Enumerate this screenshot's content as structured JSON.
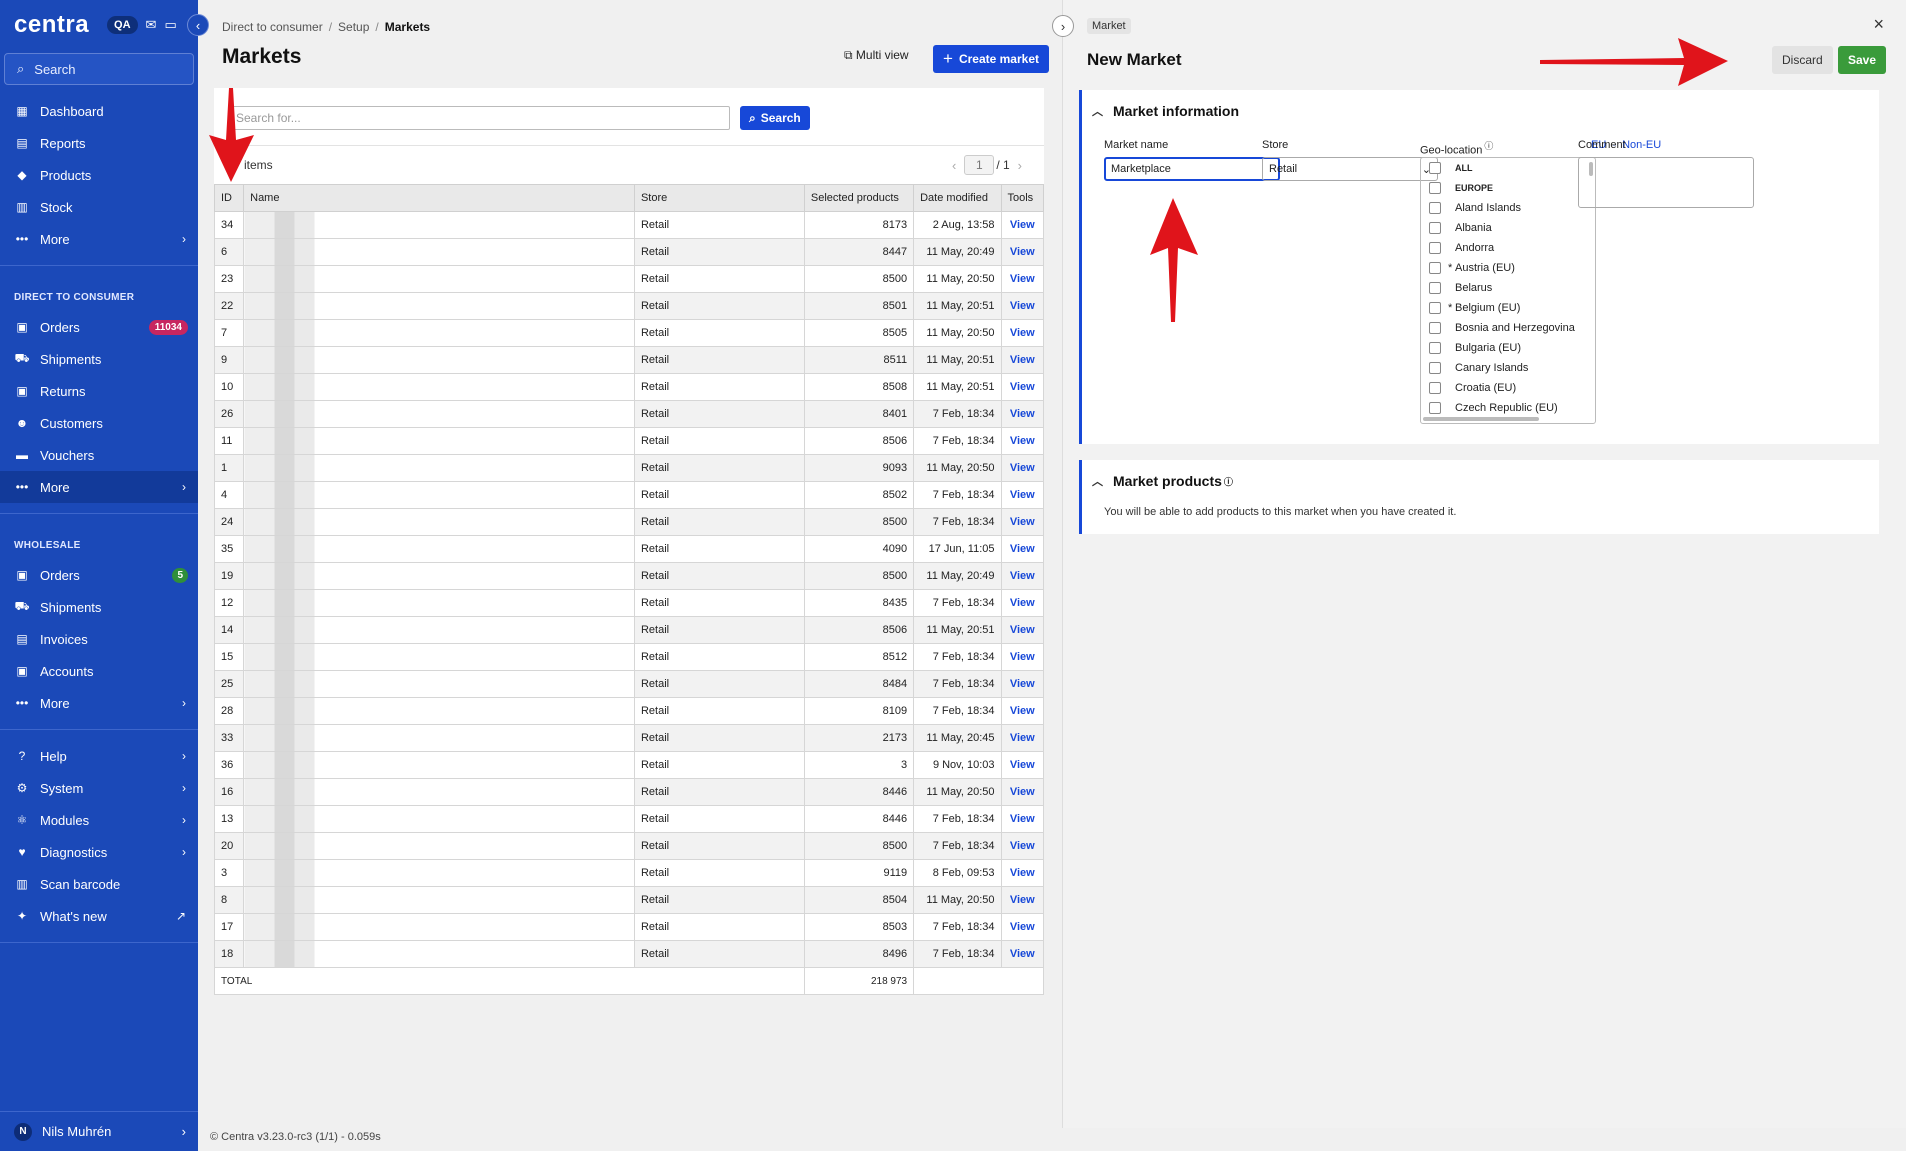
{
  "sidebar": {
    "logo": "centra",
    "env_badge": "QA",
    "search_label": "Search",
    "top_items": [
      {
        "label": "Dashboard",
        "icon": "chart-icon"
      },
      {
        "label": "Reports",
        "icon": "report-icon"
      },
      {
        "label": "Products",
        "icon": "tag-icon"
      },
      {
        "label": "Stock",
        "icon": "stock-icon"
      },
      {
        "label": "More",
        "icon": "dots-icon"
      }
    ],
    "dtc_section": "DIRECT TO CONSUMER",
    "dtc_items": [
      {
        "label": "Orders",
        "badge": "11034"
      },
      {
        "label": "Shipments"
      },
      {
        "label": "Returns"
      },
      {
        "label": "Customers"
      },
      {
        "label": "Vouchers"
      },
      {
        "label": "More"
      }
    ],
    "wholesale_section": "WHOLESALE",
    "wholesale_items": [
      {
        "label": "Orders",
        "badge": "5"
      },
      {
        "label": "Shipments"
      },
      {
        "label": "Invoices"
      },
      {
        "label": "Accounts"
      },
      {
        "label": "More"
      }
    ],
    "bottom_items": [
      {
        "label": "Help"
      },
      {
        "label": "System"
      },
      {
        "label": "Modules"
      },
      {
        "label": "Diagnostics"
      },
      {
        "label": "Scan barcode"
      },
      {
        "label": "What's new"
      }
    ],
    "user": {
      "initial": "N",
      "name": "Nils Muhrén"
    }
  },
  "breadcrumb": [
    "Direct to consumer",
    "Setup",
    "Markets"
  ],
  "page_title": "Markets",
  "multi_view": "Multi view",
  "create_market": "Create market",
  "search": {
    "placeholder": "Search for...",
    "button": "Search"
  },
  "items_label": "items",
  "pager": {
    "current": "1",
    "total": "/ 1"
  },
  "table": {
    "headers": [
      "ID",
      "Name",
      "Store",
      "Selected products",
      "Date modified",
      "Tools"
    ],
    "rows": [
      {
        "id": "34",
        "store": "Retail",
        "selected": "8173",
        "date": "2 Aug, 13:58",
        "tool": "View"
      },
      {
        "id": "6",
        "store": "Retail",
        "selected": "8447",
        "date": "11 May, 20:49",
        "tool": "View"
      },
      {
        "id": "23",
        "store": "Retail",
        "selected": "8500",
        "date": "11 May, 20:50",
        "tool": "View"
      },
      {
        "id": "22",
        "store": "Retail",
        "selected": "8501",
        "date": "11 May, 20:51",
        "tool": "View"
      },
      {
        "id": "7",
        "store": "Retail",
        "selected": "8505",
        "date": "11 May, 20:50",
        "tool": "View"
      },
      {
        "id": "9",
        "store": "Retail",
        "selected": "8511",
        "date": "11 May, 20:51",
        "tool": "View"
      },
      {
        "id": "10",
        "store": "Retail",
        "selected": "8508",
        "date": "11 May, 20:51",
        "tool": "View"
      },
      {
        "id": "26",
        "store": "Retail",
        "selected": "8401",
        "date": "7 Feb, 18:34",
        "tool": "View"
      },
      {
        "id": "11",
        "store": "Retail",
        "selected": "8506",
        "date": "7 Feb, 18:34",
        "tool": "View"
      },
      {
        "id": "1",
        "store": "Retail",
        "selected": "9093",
        "date": "11 May, 20:50",
        "tool": "View"
      },
      {
        "id": "4",
        "store": "Retail",
        "selected": "8502",
        "date": "7 Feb, 18:34",
        "tool": "View"
      },
      {
        "id": "24",
        "store": "Retail",
        "selected": "8500",
        "date": "7 Feb, 18:34",
        "tool": "View"
      },
      {
        "id": "35",
        "store": "Retail",
        "selected": "4090",
        "date": "17 Jun, 11:05",
        "tool": "View"
      },
      {
        "id": "19",
        "store": "Retail",
        "selected": "8500",
        "date": "11 May, 20:49",
        "tool": "View"
      },
      {
        "id": "12",
        "store": "Retail",
        "selected": "8435",
        "date": "7 Feb, 18:34",
        "tool": "View"
      },
      {
        "id": "14",
        "store": "Retail",
        "selected": "8506",
        "date": "11 May, 20:51",
        "tool": "View"
      },
      {
        "id": "15",
        "store": "Retail",
        "selected": "8512",
        "date": "7 Feb, 18:34",
        "tool": "View"
      },
      {
        "id": "25",
        "store": "Retail",
        "selected": "8484",
        "date": "7 Feb, 18:34",
        "tool": "View"
      },
      {
        "id": "28",
        "store": "Retail",
        "selected": "8109",
        "date": "7 Feb, 18:34",
        "tool": "View"
      },
      {
        "id": "33",
        "store": "Retail",
        "selected": "2173",
        "date": "11 May, 20:45",
        "tool": "View"
      },
      {
        "id": "36",
        "store": "Retail",
        "selected": "3",
        "date": "9 Nov, 10:03",
        "tool": "View"
      },
      {
        "id": "16",
        "store": "Retail",
        "selected": "8446",
        "date": "11 May, 20:50",
        "tool": "View"
      },
      {
        "id": "13",
        "store": "Retail",
        "selected": "8446",
        "date": "7 Feb, 18:34",
        "tool": "View"
      },
      {
        "id": "20",
        "store": "Retail",
        "selected": "8500",
        "date": "7 Feb, 18:34",
        "tool": "View"
      },
      {
        "id": "3",
        "store": "Retail",
        "selected": "9119",
        "date": "8 Feb, 09:53",
        "tool": "View"
      },
      {
        "id": "8",
        "store": "Retail",
        "selected": "8504",
        "date": "11 May, 20:50",
        "tool": "View"
      },
      {
        "id": "17",
        "store": "Retail",
        "selected": "8503",
        "date": "7 Feb, 18:34",
        "tool": "View"
      },
      {
        "id": "18",
        "store": "Retail",
        "selected": "8496",
        "date": "7 Feb, 18:34",
        "tool": "View"
      }
    ],
    "total_label": "TOTAL",
    "total_value": "218 973"
  },
  "footer": "© Centra v3.23.0-rc3 (1/1) - 0.059s",
  "panel": {
    "tag": "Market",
    "title": "New Market",
    "discard": "Discard",
    "save": "Save",
    "info_section": "Market information",
    "market_name_label": "Market name",
    "market_name_value": "Marketplace",
    "store_label": "Store",
    "store_value": "Retail",
    "geo_label": "Geo-location",
    "geo_link_eu": "EU",
    "geo_link_sep": "-",
    "geo_link_noneu": "Non-EU",
    "comment_label": "Comment",
    "geo_items": [
      {
        "label": "ALL",
        "bold": true,
        "star": false
      },
      {
        "label": "EUROPE",
        "bold": true,
        "star": false
      },
      {
        "label": "Aland Islands",
        "bold": false,
        "star": false
      },
      {
        "label": "Albania",
        "bold": false,
        "star": false
      },
      {
        "label": "Andorra",
        "bold": false,
        "star": false
      },
      {
        "label": "Austria (EU)",
        "bold": false,
        "star": true
      },
      {
        "label": "Belarus",
        "bold": false,
        "star": false
      },
      {
        "label": "Belgium (EU)",
        "bold": false,
        "star": true
      },
      {
        "label": "Bosnia and Herzegovina",
        "bold": false,
        "star": false
      },
      {
        "label": "Bulgaria (EU)",
        "bold": false,
        "star": false
      },
      {
        "label": "Canary Islands",
        "bold": false,
        "star": false
      },
      {
        "label": "Croatia (EU)",
        "bold": false,
        "star": false
      },
      {
        "label": "Czech Republic (EU)",
        "bold": false,
        "star": false
      }
    ],
    "products_section": "Market products",
    "products_text": "You will be able to add products to this market when you have created it."
  }
}
